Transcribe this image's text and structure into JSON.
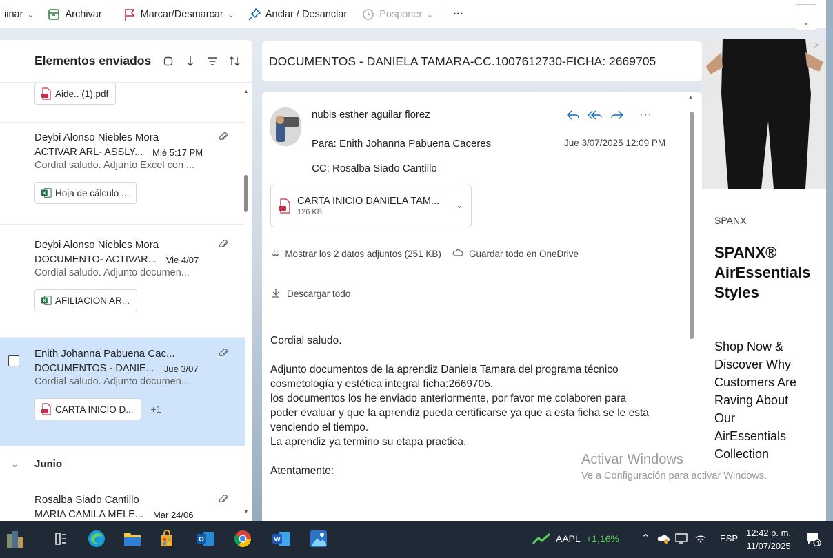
{
  "toolbar": {
    "delete_label": "iinar",
    "archive_label": "Archivar",
    "flag_label": "Marcar/Desmarcar",
    "pin_label": "Anclar / Desanclar",
    "snooze_label": "Posponer",
    "more_label": "···"
  },
  "list": {
    "folder_title": "Elementos enviados",
    "top_chip": "Aide.. (1).pdf",
    "messages": [
      {
        "sender": "Deybi Alonso Niebles Mora",
        "subject": "ACTIVAR ARL- ASSLY...",
        "date": "Mié 5:17 PM",
        "preview": "Cordial saludo. Adjunto Excel con ...",
        "chip": "Hoja de cálculo ..."
      },
      {
        "sender": "Deybi Alonso Niebles Mora",
        "subject": "DOCUMENTO- ACTIVAR...",
        "date": "Vie 4/07",
        "preview": "Cordial saludo. Adjunto documen...",
        "chip": "AFILIACION AR..."
      },
      {
        "sender": "Enith Johanna Pabuena Cac...",
        "subject": "DOCUMENTOS - DANIE...",
        "date": "Jue 3/07",
        "preview": "Cordial saludo. Adjunto documen...",
        "chip": "CARTA INICIO D...",
        "chip_extra": "+1"
      },
      {
        "sender": "Rosalba Siado Cantillo",
        "subject": "MARIA CAMILA MELE...",
        "date": "Mar 24/06"
      }
    ],
    "month_group": "Junio"
  },
  "email": {
    "subject": "DOCUMENTOS - DANIELA TAMARA-CC.1007612730-FICHA: 2669705",
    "from": "nubis esther aguilar florez",
    "to": "Para:  Enith Johanna Pabuena Caceres",
    "cc": "CC:  Rosalba Siado Cantillo",
    "date": "Jue 3/07/2025 12:09 PM",
    "attachment_name": "CARTA INICIO DANIELA TAM...",
    "attachment_size": "126 KB",
    "show_attachments": "Mostrar los 2 datos adjuntos (251 KB)",
    "save_onedrive": "Guardar todo en OneDrive",
    "download_all": "Descargar todo",
    "body_greeting": "Cordial saludo.",
    "body_p1_l1": "Adjunto documentos de la aprendiz Daniela Tamara del programa técnico",
    "body_p1_l2": "cosmetología y estética  integral ficha:2669705.",
    "body_p1_l3": "los documentos los he enviado anteriormente, por favor me colaboren para",
    "body_p1_l4": "poder evaluar y que la aprendiz pueda certificarse ya que a esta ficha se le esta",
    "body_p1_l5": "venciendo el tiempo.",
    "body_p1_l6": "La aprendiz ya termino su etapa practica,",
    "body_closing": "Atentamente:"
  },
  "ad": {
    "brand": "SPANX",
    "title_l1": "SPANX®",
    "title_l2": "AirEssentials",
    "title_l3": "Styles",
    "desc_l1": "Shop Now &",
    "desc_l2": "Discover Why",
    "desc_l3": "Customers Are",
    "desc_l4": "Raving About",
    "desc_l5": "Our",
    "desc_l6": "AirEssentials",
    "desc_l7": "Collection"
  },
  "watermark": {
    "line1": "Activar Windows",
    "line2": "Ve a Configuración para activar Windows."
  },
  "taskbar": {
    "stock_symbol": "AAPL",
    "stock_change": "+1,16%",
    "language": "ESP",
    "time": "12:42 p. m.",
    "date": "11/07/2025",
    "notification_count": "1"
  },
  "colors": {
    "accent": "#0f6cbd",
    "selected_row": "#cfe4fa",
    "flag_red": "#c4314b",
    "taskbar_bg": "#1f2a36",
    "stock_green": "#5bd15b"
  }
}
